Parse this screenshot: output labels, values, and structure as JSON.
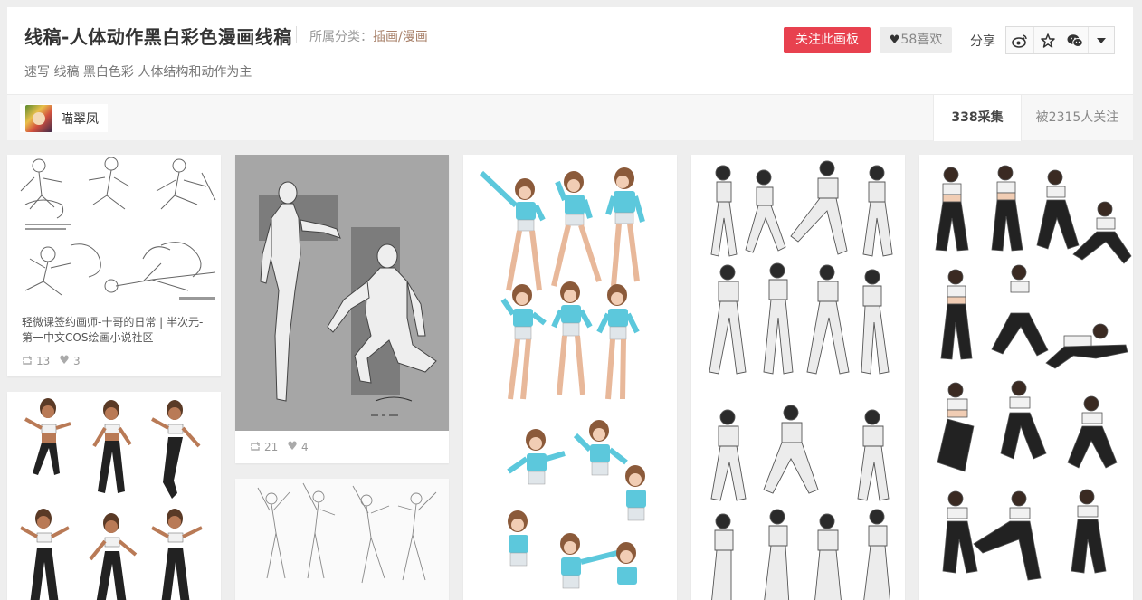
{
  "board": {
    "title": "线稿-人体动作黑白彩色漫画线稿",
    "category_prefix": "所属分类：",
    "category": "插画/漫画",
    "description": "速写 线稿 黑白色彩 人体结构和动作为主",
    "follow_label": "关注此画板",
    "like_label": "58喜欢",
    "share_label": "分享",
    "owner_name": "喵翠凤",
    "pins_stat": "338采集",
    "followers_stat": "被2315人关注"
  },
  "share_icons": [
    "weibo-icon",
    "star-icon",
    "wechat-icon",
    "chevron-down-icon"
  ],
  "colors": {
    "accent": "#e8414f",
    "category_link": "#a8816a",
    "teal_shirt": "#5cc8dc",
    "skin": "#e8b89a"
  },
  "pins": [
    {
      "description": "轻微课签约画师-十哥的日常 | 半次元-第一中文COS绘画小说社区",
      "repins": "13",
      "likes": "3"
    },
    {
      "description": "",
      "repins": "21",
      "likes": "4"
    }
  ]
}
